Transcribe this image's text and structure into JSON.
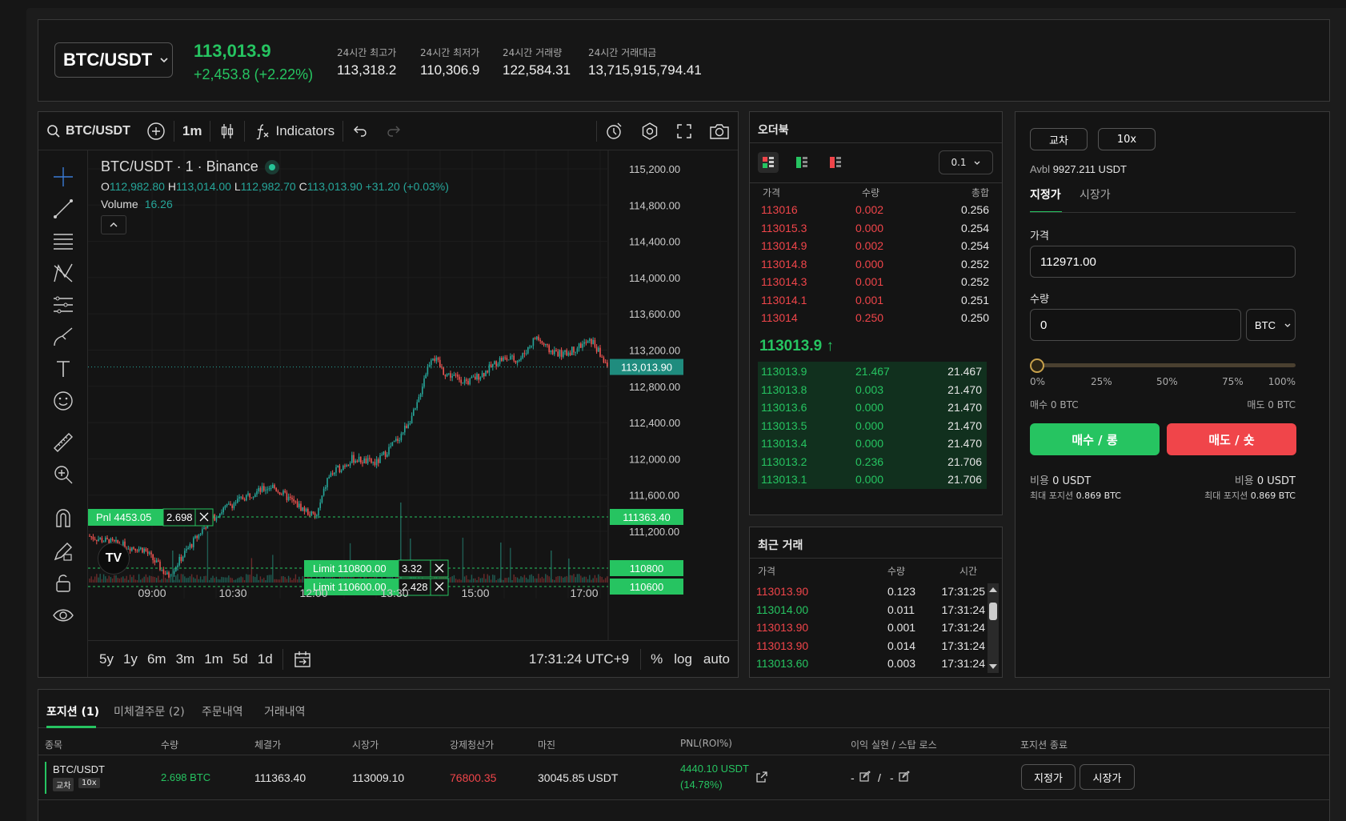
{
  "header": {
    "pair": "BTC/USDT",
    "last_price": "113,013.9",
    "change": "+2,453.8 (+2.22%)",
    "stats": [
      {
        "label": "24시간 최고가",
        "value": "113,318.2"
      },
      {
        "label": "24시간 최저가",
        "value": "110,306.9"
      },
      {
        "label": "24시간 거래량",
        "value": "122,584.31"
      },
      {
        "label": "24시간 거래대금",
        "value": "13,715,915,794.41"
      }
    ]
  },
  "chart": {
    "symbol": "BTC/USDT",
    "interval": "1m",
    "indicators_label": "Indicators",
    "title": "BTC/USDT · 1 · Binance",
    "ohlc": {
      "o_label": "O",
      "o": "112,982.80",
      "h_label": "H",
      "h": "113,014.00",
      "l_label": "L",
      "l": "112,982.70",
      "c_label": "C",
      "c": "113,013.90",
      "chg": "+31.20 (+0.03%)"
    },
    "volume_label": "Volume",
    "volume_value": "16.26",
    "y_ticks": [
      "115,200.00",
      "114,800.00",
      "114,400.00",
      "114,000.00",
      "113,600.00",
      "113,200.00",
      "112,800.00",
      "112,400.00",
      "112,000.00",
      "111,600.00",
      "111,200.00"
    ],
    "x_ticks": [
      "09:00",
      "10:30",
      "12:00",
      "13:30",
      "15:00",
      "17:00"
    ],
    "current_price_tag": "113,013.90",
    "entry_price_tag": "111363.40",
    "limit_tags": [
      "110800",
      "110600"
    ],
    "pnl_label": "Pnl 4453.05",
    "pnl_qty": "2.698",
    "limit_orders": [
      {
        "label": "Limit 110800.00",
        "qty": "3.32"
      },
      {
        "label": "Limit 110600.00",
        "qty": "2.428"
      }
    ],
    "ranges": [
      "5y",
      "1y",
      "6m",
      "3m",
      "1m",
      "5d",
      "1d"
    ],
    "time": "17:31:24 UTC+9",
    "scale_opts": [
      "%",
      "log",
      "auto"
    ],
    "logo": "TV"
  },
  "orderbook": {
    "title": "오더북",
    "precision": "0.1",
    "headers": [
      "가격",
      "수량",
      "총합"
    ],
    "asks": [
      [
        "113016",
        "0.002",
        "0.256"
      ],
      [
        "113015.3",
        "0.000",
        "0.254"
      ],
      [
        "113014.9",
        "0.002",
        "0.254"
      ],
      [
        "113014.8",
        "0.000",
        "0.252"
      ],
      [
        "113014.3",
        "0.001",
        "0.252"
      ],
      [
        "113014.1",
        "0.001",
        "0.251"
      ],
      [
        "113014",
        "0.250",
        "0.250"
      ]
    ],
    "mid_price": "113013.9 ↑",
    "bids": [
      [
        "113013.9",
        "21.467",
        "21.467"
      ],
      [
        "113013.8",
        "0.003",
        "21.470"
      ],
      [
        "113013.6",
        "0.000",
        "21.470"
      ],
      [
        "113013.5",
        "0.000",
        "21.470"
      ],
      [
        "113013.4",
        "0.000",
        "21.470"
      ],
      [
        "113013.2",
        "0.236",
        "21.706"
      ],
      [
        "113013.1",
        "0.000",
        "21.706"
      ]
    ]
  },
  "recent_trades": {
    "title": "최근 거래",
    "headers": [
      "가격",
      "수량",
      "시간"
    ],
    "rows": [
      {
        "price": "113013.90",
        "qty": "0.123",
        "time": "17:31:25",
        "side": "sell"
      },
      {
        "price": "113014.00",
        "qty": "0.011",
        "time": "17:31:24",
        "side": "buy"
      },
      {
        "price": "113013.90",
        "qty": "0.001",
        "time": "17:31:24",
        "side": "sell"
      },
      {
        "price": "113013.90",
        "qty": "0.014",
        "time": "17:31:24",
        "side": "sell"
      },
      {
        "price": "113013.60",
        "qty": "0.003",
        "time": "17:31:24",
        "side": "buy"
      }
    ]
  },
  "order_form": {
    "margin_mode": "교차",
    "leverage": "10x",
    "avbl_label": "Avbl",
    "avbl_value": "9927.211 USDT",
    "tab_limit": "지정가",
    "tab_market": "시장가",
    "price_label": "가격",
    "price_value": "112971.00",
    "qty_label": "수량",
    "qty_value": "0",
    "qty_unit": "BTC",
    "slider_percent": 0,
    "slider_marks": [
      "0%",
      "25%",
      "50%",
      "75%",
      "100%"
    ],
    "buy_amount": "매수 0 BTC",
    "sell_amount": "매도 0 BTC",
    "buy_button": "매수 / 롱",
    "sell_button": "매도 / 숏",
    "cost_label": "비용",
    "buy_cost": "0 USDT",
    "sell_cost": "0 USDT",
    "max_pos_label": "최대 포지션",
    "buy_max": "0.869 BTC",
    "sell_max": "0.869 BTC"
  },
  "positions": {
    "tabs": [
      "포지션 (1)",
      "미체결주문 (2)",
      "주문내역",
      "거래내역"
    ],
    "columns": [
      "종목",
      "수량",
      "체결가",
      "시장가",
      "강제청산가",
      "마진",
      "PNL(ROI%)",
      "이익 실현 / 스탑 로스",
      "포지션 종료"
    ],
    "row": {
      "symbol": "BTC/USDT",
      "margin_badge": "교차",
      "lev_badge": "10x",
      "qty": "2.698 BTC",
      "entry": "111363.40",
      "mark": "113009.10",
      "liq": "76800.35",
      "margin": "30045.85 USDT",
      "pnl": "4440.10 USDT",
      "roi": "(14.78%)",
      "tp_sl_a": "-",
      "tp_sl_sep": "/",
      "tp_sl_b": "-",
      "close_limit": "지정가",
      "close_market": "시장가"
    }
  },
  "colors": {
    "green": "#26c461",
    "red": "#f0454a",
    "bg": "#141414"
  }
}
